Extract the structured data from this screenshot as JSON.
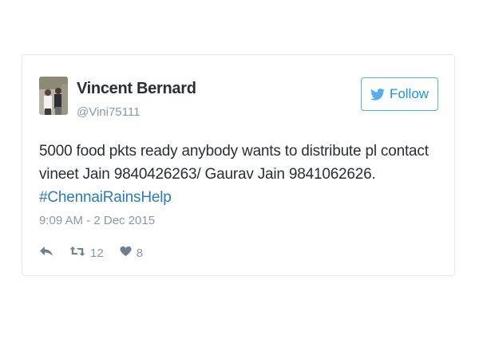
{
  "tweet": {
    "author": {
      "name": "Vincent Bernard",
      "handle": "@Vini75111"
    },
    "follow_label": "Follow",
    "text_lines": [
      "5000 food pkts ready anybody wants to distribute pl contact",
      "vineet Jain 9840426263/ Gaurav Jain 9841062626."
    ],
    "hashtag": "#ChennaiRainsHelp",
    "timestamp": "9:09 AM - 2 Dec 2015",
    "retweet_count": "12",
    "like_count": "8"
  },
  "icons": {
    "follow": "twitter-bird-icon",
    "reply": "reply-icon",
    "retweet": "retweet-icon",
    "like": "heart-icon"
  },
  "colors": {
    "accent": "#1b95e0",
    "hashtag": "#2b7bb9",
    "muted": "#8899a6",
    "text": "#292f33",
    "border": "#e1e8ed"
  }
}
